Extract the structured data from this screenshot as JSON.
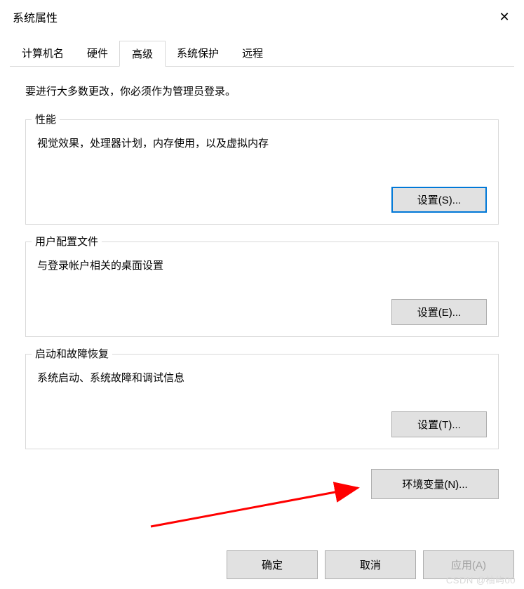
{
  "window": {
    "title": "系统属性"
  },
  "tabs": [
    {
      "label": "计算机名"
    },
    {
      "label": "硬件"
    },
    {
      "label": "高级"
    },
    {
      "label": "系统保护"
    },
    {
      "label": "远程"
    }
  ],
  "active_tab_index": 2,
  "admin_note": "要进行大多数更改，你必须作为管理员登录。",
  "groups": {
    "performance": {
      "legend": "性能",
      "description": "视觉效果，处理器计划，内存使用，以及虚拟内存",
      "button": "设置(S)..."
    },
    "user_profile": {
      "legend": "用户配置文件",
      "description": "与登录帐户相关的桌面设置",
      "button": "设置(E)..."
    },
    "startup_recovery": {
      "legend": "启动和故障恢复",
      "description": "系统启动、系统故障和调试信息",
      "button": "设置(T)..."
    }
  },
  "env_button": "环境变量(N)...",
  "footer": {
    "ok": "确定",
    "cancel": "取消",
    "apply": "应用(A)"
  },
  "watermark": "CSDN @柚屿00"
}
